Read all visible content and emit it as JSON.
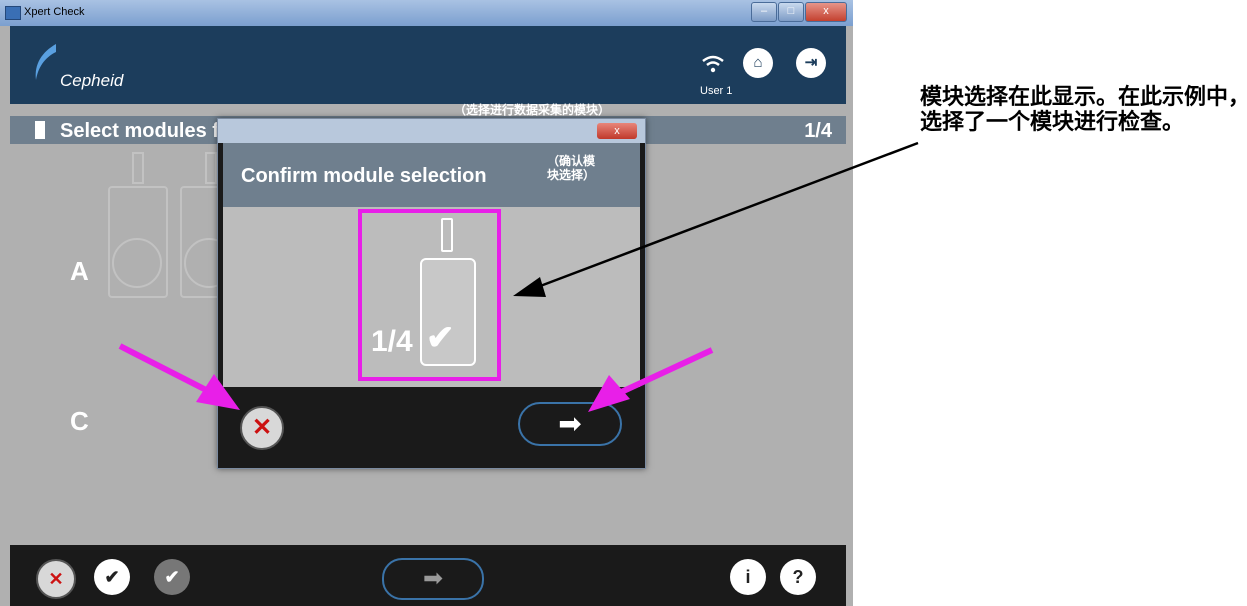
{
  "window": {
    "title": "Xpert Check",
    "minimize": "–",
    "maximize": "□",
    "close": "x"
  },
  "header": {
    "logo_text": "Cepheid",
    "user": "User 1",
    "home_icon": "home-icon",
    "exit_icon": "exit-icon"
  },
  "annotations": {
    "top_small": "（选择进行数据采集的模块）",
    "confirm_small": "（确认模\n块选择）",
    "side_note": "模块选择在此显示。在此示例中，选择了一个模块进行检查。"
  },
  "page": {
    "title": "Select modules for data collection",
    "count": "1/4",
    "rows": [
      "A",
      "C"
    ]
  },
  "dialog": {
    "title": "Confirm module selection",
    "module_label": "1/4",
    "check_icon": "check-icon",
    "close_label": "x",
    "next_icon": "arrow-right-icon"
  },
  "footer": {
    "icons": [
      "cancel-icon",
      "select-all-icon",
      "deselect-all-icon",
      "arrow-right-icon",
      "info-icon",
      "help-icon"
    ],
    "info": "i",
    "help": "?"
  },
  "colors": {
    "highlight": "#e81fe8",
    "header": "#1c3d5c",
    "subheader": "#6f7f8e"
  }
}
